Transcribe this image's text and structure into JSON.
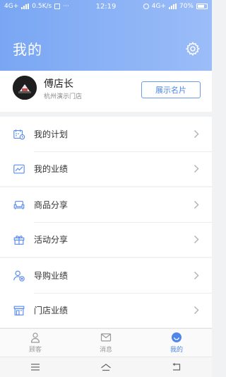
{
  "status_bar": {
    "network": "4G+",
    "speed": "0.5K/s",
    "time": "12:19",
    "right_network": "4G+",
    "battery": "70%"
  },
  "header": {
    "title": "我的",
    "settings_icon": "gear-icon"
  },
  "profile": {
    "name": "傅店长",
    "store": "杭州演示门店",
    "card_button": "展示名片"
  },
  "menu": {
    "group1": [
      {
        "label": "我的计划",
        "icon": "calendar-icon"
      },
      {
        "label": "我的业绩",
        "icon": "trend-icon"
      }
    ],
    "group2": [
      {
        "label": "商品分享",
        "icon": "sofa-icon"
      },
      {
        "label": "活动分享",
        "icon": "gift-icon"
      }
    ],
    "group3": [
      {
        "label": "导购业绩",
        "icon": "user-badge-icon"
      },
      {
        "label": "门店业绩",
        "icon": "store-icon"
      }
    ]
  },
  "tabs": [
    {
      "label": "顾客",
      "icon": "person-icon",
      "active": false
    },
    {
      "label": "消息",
      "icon": "mail-icon",
      "active": false
    },
    {
      "label": "我的",
      "icon": "smile-icon",
      "active": true
    }
  ],
  "colors": {
    "accent": "#4f86ea",
    "header_start": "#79a6f3",
    "header_end": "#9bbdf8"
  }
}
